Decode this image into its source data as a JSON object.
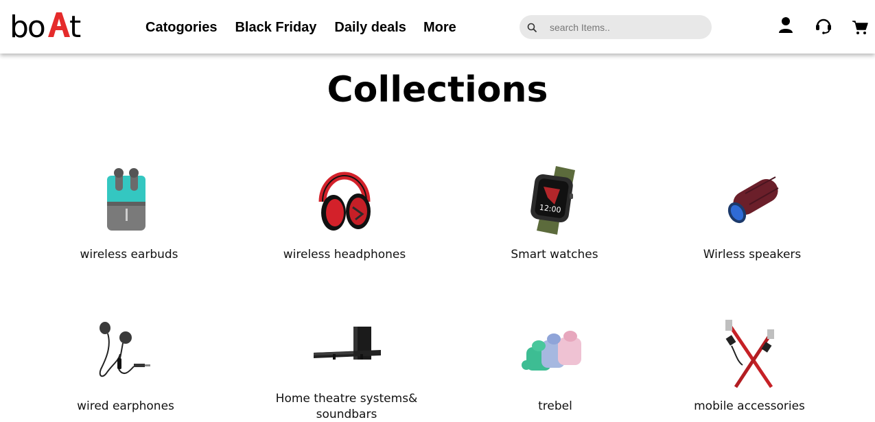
{
  "brand": {
    "logo_text": "boAt",
    "accent_color": "#e52b2b"
  },
  "nav": {
    "items": [
      {
        "label": "Catogories"
      },
      {
        "label": "Black Friday"
      },
      {
        "label": "Daily deals"
      },
      {
        "label": "More"
      }
    ]
  },
  "search": {
    "placeholder": "search Items..",
    "value": "",
    "icon": "search-icon"
  },
  "header_icons": [
    "user-icon",
    "headset-icon",
    "cart-icon"
  ],
  "page_title": "Collections",
  "collections": [
    {
      "label": "wireless earbuds",
      "icon": "earbuds-image"
    },
    {
      "label": "wireless headphones",
      "icon": "headphones-image"
    },
    {
      "label": "Smart watches",
      "icon": "smartwatch-image"
    },
    {
      "label": "Wirless speakers",
      "icon": "speaker-image"
    },
    {
      "label": "wired earphones",
      "icon": "wired-earphones-image"
    },
    {
      "label": "Home theatre systems& soundbars",
      "icon": "soundbar-image"
    },
    {
      "label": "trebel",
      "icon": "trebel-earbuds-image"
    },
    {
      "label": "mobile accessories",
      "icon": "cable-image"
    }
  ]
}
